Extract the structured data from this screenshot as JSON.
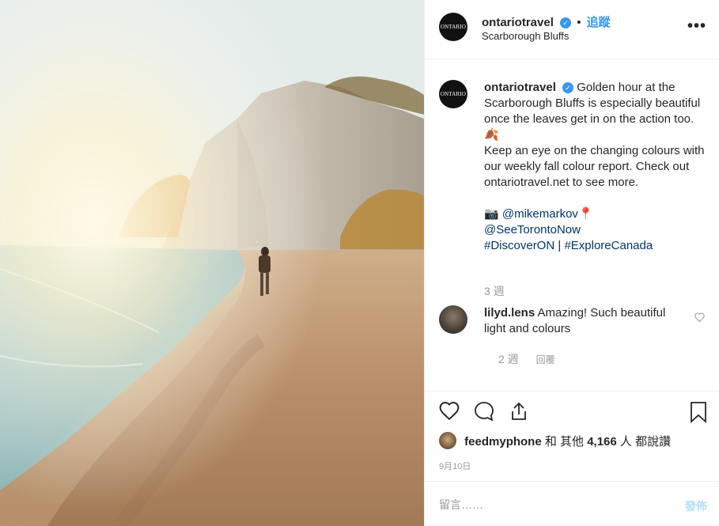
{
  "post": {
    "author": "ontariotravel",
    "verified": "✓",
    "separator": "•",
    "follow_label": "追蹤",
    "location": "Scarborough Bluffs",
    "avatar_text": "ONTARIO",
    "more_label": "•••"
  },
  "caption": {
    "author": "ontariotravel",
    "text_1": "Golden hour at the Scarborough Bluffs is especially beautiful once the leaves get in on the action too. 🍂",
    "text_2": "Keep an eye on the changing colours with our weekly fall colour report. Check out ontariotravel.net to see more.",
    "camera": "📷",
    "mention_1": "@mikemarkov",
    "pin": "📍",
    "mention_2": "@SeeTorontoNow",
    "hashtag_1": "#DiscoverON",
    "divider": "|",
    "hashtag_2": "#ExploreCanada",
    "time": "3 週"
  },
  "comments": [
    {
      "author": "lilyd.lens",
      "text": "Amazing! Such beautiful light and colours",
      "time": "2 週",
      "reply_label": "回覆"
    }
  ],
  "likes": {
    "first_user": "feedmyphone",
    "and": "和 其他",
    "count": "4,166",
    "suffix": "人 都說讚"
  },
  "date": "9月10日",
  "add_comment": {
    "placeholder": "留言……",
    "post_label": "發佈"
  },
  "colors": {
    "accent": "#3897f0",
    "link": "#003569",
    "muted": "#999999",
    "post_disabled": "#b2dffc"
  }
}
